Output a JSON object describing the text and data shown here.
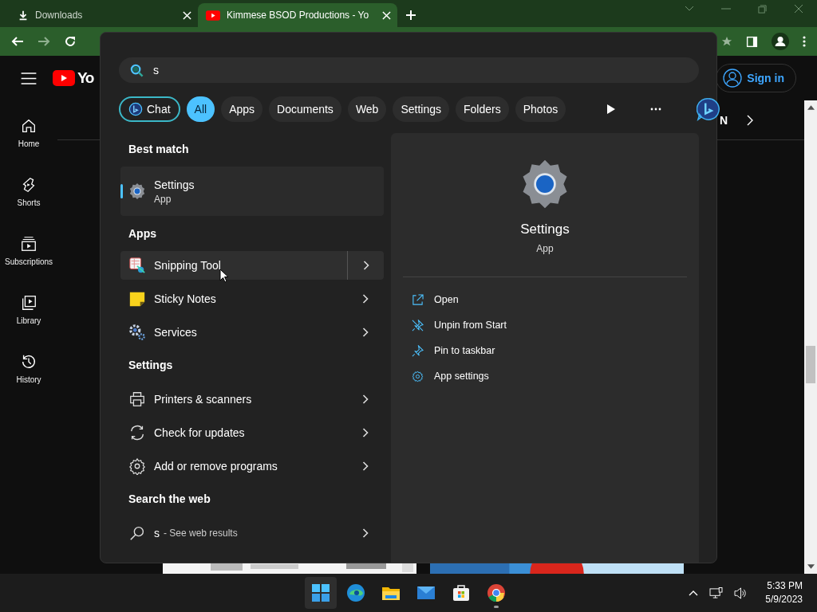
{
  "browser": {
    "tabs": [
      {
        "title": "Downloads",
        "kind": "download",
        "selected": false
      },
      {
        "title": "Kimmese BSOD Productions - Yo",
        "kind": "youtube",
        "selected": true
      }
    ]
  },
  "youtube": {
    "logo": "Yo",
    "sign_in": "Sign in",
    "chip_fragment": "N",
    "sidebar": [
      {
        "label": "Home",
        "kind": "home"
      },
      {
        "label": "Shorts",
        "kind": "shorts"
      },
      {
        "label": "Subscriptions",
        "kind": "subscriptions"
      },
      {
        "label": "Library",
        "kind": "library"
      },
      {
        "label": "History",
        "kind": "history"
      }
    ]
  },
  "search": {
    "query": "s",
    "filters": [
      {
        "label": "Chat",
        "kind": "chat",
        "selected": false
      },
      {
        "label": "All",
        "kind": "text",
        "selected": true
      },
      {
        "label": "Apps",
        "kind": "text",
        "selected": false
      },
      {
        "label": "Documents",
        "kind": "text",
        "selected": false
      },
      {
        "label": "Web",
        "kind": "text",
        "selected": false
      },
      {
        "label": "Settings",
        "kind": "text",
        "selected": false
      },
      {
        "label": "Folders",
        "kind": "text",
        "selected": false
      },
      {
        "label": "Photos",
        "kind": "text",
        "selected": false
      }
    ],
    "sections": [
      {
        "heading": "Best match",
        "kind": "best",
        "items": [
          {
            "title": "Settings",
            "subtitle": "App",
            "kind": "settings",
            "selected": true,
            "hovered": false
          }
        ]
      },
      {
        "heading": "Apps",
        "kind": "list",
        "items": [
          {
            "title": "Snipping Tool",
            "kind": "snipping",
            "selected": false,
            "hovered": true
          },
          {
            "title": "Sticky Notes",
            "kind": "sticky",
            "selected": false,
            "hovered": false
          },
          {
            "title": "Services",
            "kind": "services",
            "selected": false,
            "hovered": false
          }
        ]
      },
      {
        "heading": "Settings",
        "kind": "list",
        "items": [
          {
            "title": "Printers & scanners",
            "kind": "printer",
            "selected": false,
            "hovered": false
          },
          {
            "title": "Check for updates",
            "kind": "update",
            "selected": false,
            "hovered": false
          },
          {
            "title": "Add or remove programs",
            "kind": "gear",
            "selected": false,
            "hovered": false
          }
        ]
      },
      {
        "heading": "Search the web",
        "kind": "list",
        "items": [
          {
            "title": "s",
            "note": "- See web results",
            "kind": "search",
            "selected": false,
            "hovered": false
          }
        ]
      }
    ],
    "preview": {
      "title": "Settings",
      "subtitle": "App",
      "actions": [
        {
          "label": "Open",
          "kind": "open"
        },
        {
          "label": "Unpin from Start",
          "kind": "unpin"
        },
        {
          "label": "Pin to taskbar",
          "kind": "pin"
        },
        {
          "label": "App settings",
          "kind": "gear"
        }
      ]
    }
  },
  "taskbar": {
    "apps": [
      {
        "kind": "start",
        "active": true,
        "running": false
      },
      {
        "kind": "edge",
        "active": false,
        "running": false
      },
      {
        "kind": "explorer",
        "active": false,
        "running": false
      },
      {
        "kind": "mail",
        "active": false,
        "running": false
      },
      {
        "kind": "store",
        "active": false,
        "running": false
      },
      {
        "kind": "chrome",
        "active": false,
        "running": true
      }
    ],
    "time": "5:33 PM",
    "date": "5/9/2023"
  }
}
